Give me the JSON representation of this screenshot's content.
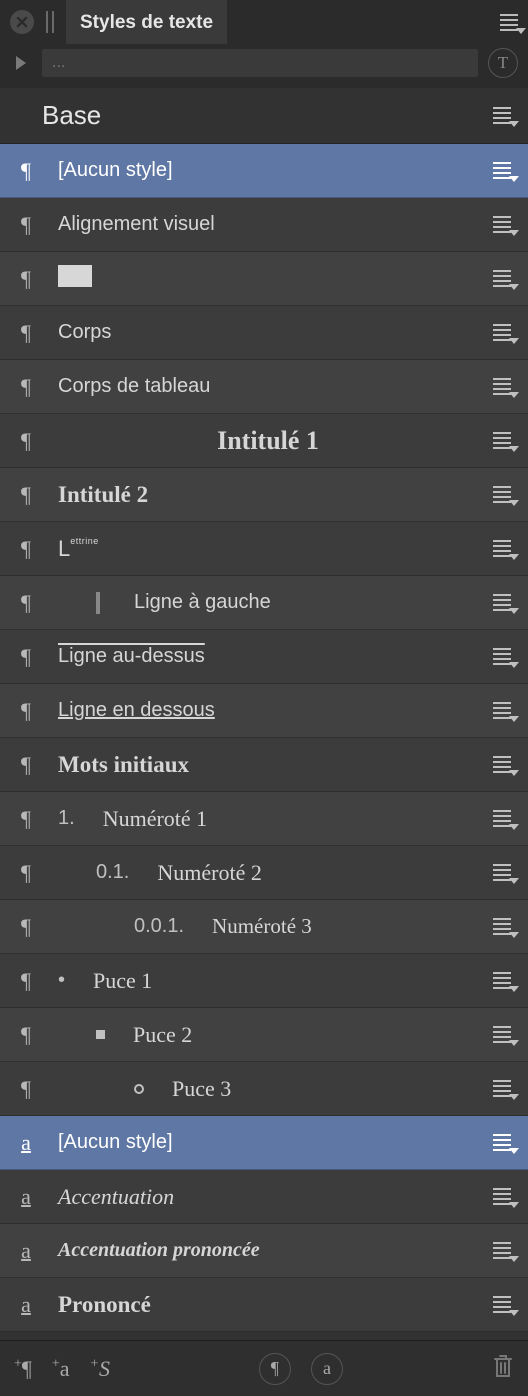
{
  "titlebar": {
    "tab_label": "Styles de texte"
  },
  "filter": {
    "placeholder": "..."
  },
  "groups": [
    {
      "label": "Base"
    }
  ],
  "styles": [
    {
      "type": "para",
      "label": "[Aucun style]",
      "selected": true,
      "indent": 0,
      "classes": ""
    },
    {
      "type": "para",
      "label": "Alignement visuel",
      "indent": 0,
      "classes": ""
    },
    {
      "type": "para",
      "label": "",
      "swatch": true,
      "indent": 0,
      "classes": ""
    },
    {
      "type": "para",
      "label": "Corps",
      "indent": 0,
      "classes": ""
    },
    {
      "type": "para",
      "label": "Corps de tableau",
      "indent": 0,
      "classes": ""
    },
    {
      "type": "para",
      "label": "Intitulé 1",
      "indent": 0,
      "classes": "s-serif s-bold s-big",
      "align": "center"
    },
    {
      "type": "para",
      "label": "Intitulé 2",
      "indent": 0,
      "classes": "s-serif s-bold s-mid"
    },
    {
      "type": "para",
      "label": "L",
      "lettrine": "ettrine",
      "indent": 0,
      "classes": "s-lettrine"
    },
    {
      "type": "para",
      "label": "Ligne à gauche",
      "indent": 1,
      "prefix_rule": true,
      "classes": ""
    },
    {
      "type": "para",
      "label": "Ligne au-dessus",
      "indent": 0,
      "classes": "s-overline"
    },
    {
      "type": "para",
      "label": "Ligne en dessous",
      "indent": 0,
      "classes": "s-underline"
    },
    {
      "type": "para",
      "label": "Mots initiaux",
      "indent": 0,
      "classes": "s-serif s-bold s-mid"
    },
    {
      "type": "para",
      "label": "Numéroté 1",
      "prefix": "1.",
      "indent": 0,
      "classes": "s-serif",
      "size": 22
    },
    {
      "type": "para",
      "label": "Numéroté 2",
      "prefix": "0.1.",
      "indent": 1,
      "classes": "s-serif",
      "size": 22
    },
    {
      "type": "para",
      "label": "Numéroté 3",
      "prefix": "0.0.1.",
      "indent": 2,
      "classes": "s-serif",
      "size": 21
    },
    {
      "type": "para",
      "label": "Puce 1",
      "bullet": "dot",
      "indent": 0,
      "classes": "s-serif",
      "size": 22
    },
    {
      "type": "para",
      "label": "Puce 2",
      "bullet": "square",
      "indent": 1,
      "classes": "s-serif",
      "size": 22
    },
    {
      "type": "para",
      "label": "Puce 3",
      "bullet": "ring",
      "indent": 2,
      "classes": "s-serif",
      "size": 22
    },
    {
      "type": "char",
      "label": "[Aucun style]",
      "selected": true,
      "indent": 0,
      "classes": ""
    },
    {
      "type": "char",
      "label": "Accentuation",
      "indent": 0,
      "classes": "s-serif s-italic",
      "size": 22
    },
    {
      "type": "char",
      "label": "Accentuation prononcée",
      "indent": 0,
      "classes": "s-serif s-italic s-bold",
      "size": 20
    },
    {
      "type": "char",
      "label": "Prononcé",
      "indent": 0,
      "classes": "s-serif s-bold s-mid"
    }
  ],
  "footer": {
    "add_para": "¶",
    "add_char": "a",
    "add_group": "S",
    "apply_para": "¶",
    "apply_char": "a"
  }
}
